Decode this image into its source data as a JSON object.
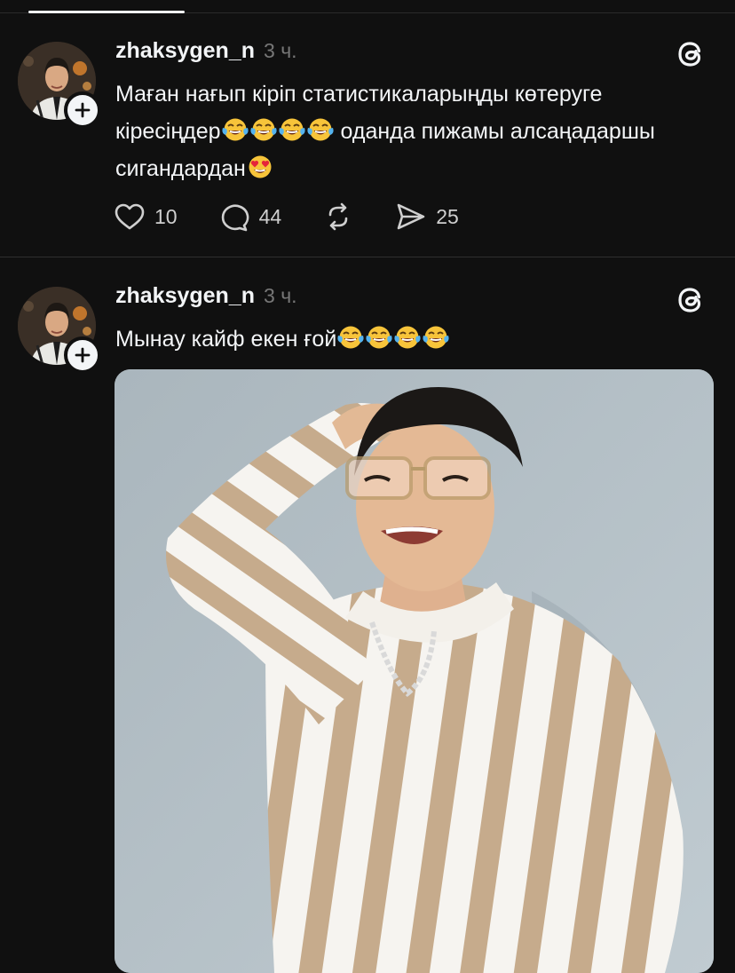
{
  "posts": [
    {
      "username": "zhaksygen_n",
      "time": "3 ч.",
      "text_parts": [
        "Маған нағып кіріп статистикаларыңды көтеруге кіресіңдер",
        " оданда пижамы алсаңадаршы сигандардан"
      ],
      "emojis": [
        "tears-of-joy",
        "tears-of-joy",
        "tears-of-joy",
        "tears-of-joy",
        "heart-eyes"
      ],
      "actions": {
        "likes": "10",
        "comments": "44",
        "shares": "25"
      }
    },
    {
      "username": "zhaksygen_n",
      "time": "3 ч.",
      "text_parts": [
        "Мынау кайф екен ғой"
      ],
      "emojis": [
        "tears-of-joy",
        "tears-of-joy",
        "tears-of-joy",
        "tears-of-joy"
      ],
      "image": "photo of a man in a beige-and-white vertically striped shirt, glasses and a silver chain, smiling with hand on head, against a light grey-blue backdrop"
    }
  ],
  "icons": [
    "heart-icon",
    "comment-icon",
    "repost-icon",
    "share-icon",
    "threads-logo-icon",
    "plus-icon"
  ],
  "colors": {
    "background": "#101010",
    "text": "#f3f5f7",
    "muted": "#777777",
    "divider": "#2f2f2f"
  }
}
